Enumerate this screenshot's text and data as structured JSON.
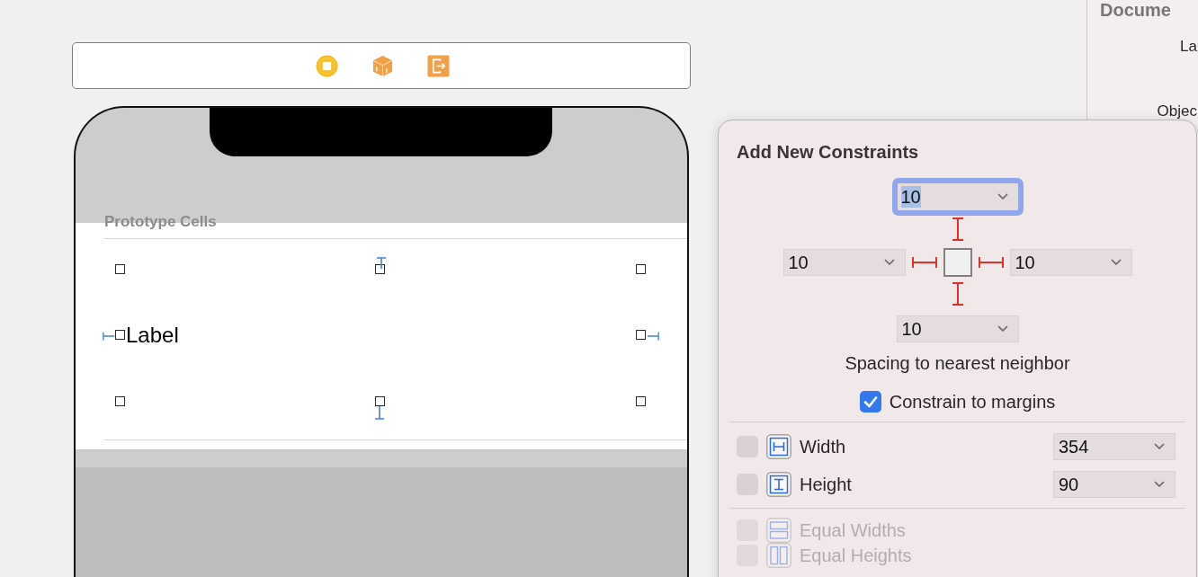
{
  "canvas": {
    "section_header": "Prototype Cells",
    "cell": {
      "label": "Label",
      "selected": true
    }
  },
  "popover": {
    "title": "Add New Constraints",
    "spacing": {
      "top": {
        "value": "10",
        "focused": true,
        "enabled": true
      },
      "left": {
        "value": "10",
        "focused": false,
        "enabled": true
      },
      "right": {
        "value": "10",
        "focused": false,
        "enabled": true
      },
      "bottom": {
        "value": "10",
        "focused": false,
        "enabled": true
      }
    },
    "spacing_caption": "Spacing to nearest neighbor",
    "constrain_to_margins": {
      "label": "Constrain to margins",
      "checked": true
    },
    "size_rows": [
      {
        "kind": "width",
        "label": "Width",
        "value": "354",
        "checked": false,
        "disabled": false
      },
      {
        "kind": "height",
        "label": "Height",
        "value": "90",
        "checked": false,
        "disabled": false
      }
    ],
    "equal_rows": [
      {
        "kind": "equal-widths",
        "label": "Equal Widths",
        "checked": false,
        "disabled": true
      },
      {
        "kind": "equal-heights",
        "label": "Equal Heights",
        "checked": false,
        "disabled": true
      }
    ]
  },
  "inspector": {
    "title": "Docume",
    "labels": [
      "La",
      "Objec"
    ]
  }
}
